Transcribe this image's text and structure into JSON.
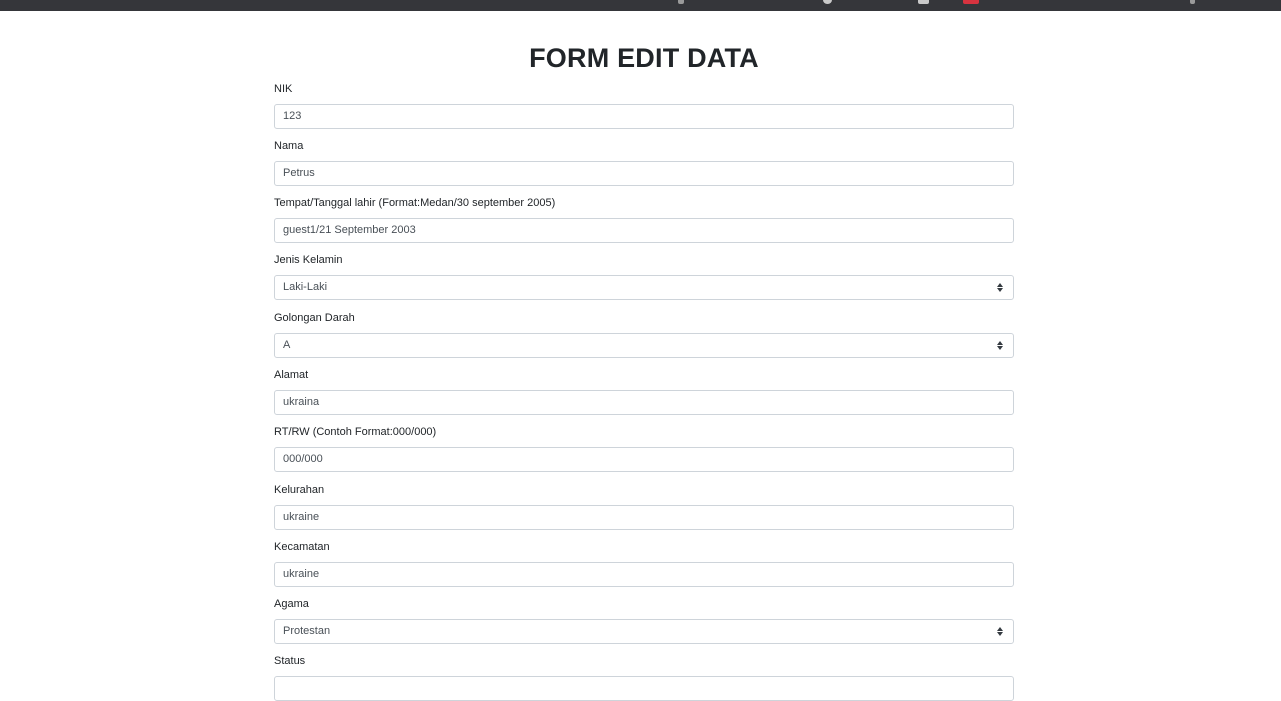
{
  "title": "FORM EDIT DATA",
  "fields": [
    {
      "label": "NIK",
      "value": "123",
      "type": "input"
    },
    {
      "label": "Nama",
      "value": "Petrus",
      "type": "input"
    },
    {
      "label": "Tempat/Tanggal lahir (Format:Medan/30 september 2005)",
      "value": "guest1/21 September 2003",
      "type": "input"
    },
    {
      "label": "Jenis Kelamin",
      "value": "Laki-Laki",
      "type": "select"
    },
    {
      "label": "Golongan Darah",
      "value": "A",
      "type": "select"
    },
    {
      "label": "Alamat",
      "value": "ukraina",
      "type": "input"
    },
    {
      "label": "RT/RW (Contoh Format:000/000)",
      "value": "000/000",
      "type": "input"
    },
    {
      "label": "Kelurahan",
      "value": "ukraine",
      "type": "input"
    },
    {
      "label": "Kecamatan",
      "value": "ukraine",
      "type": "input"
    },
    {
      "label": "Agama",
      "value": "Protestan",
      "type": "select"
    },
    {
      "label": "Status",
      "value": "",
      "type": "select"
    }
  ]
}
